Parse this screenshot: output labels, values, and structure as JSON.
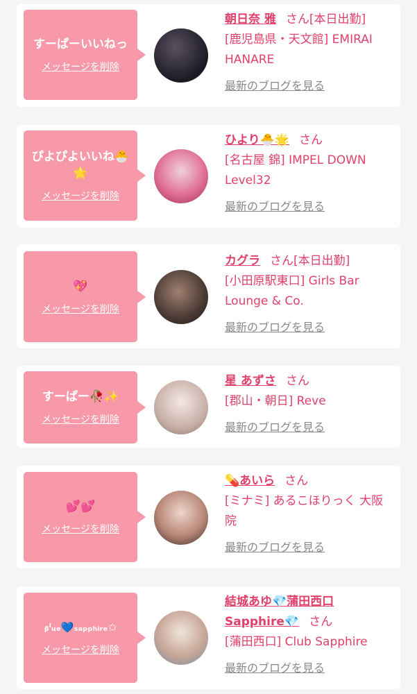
{
  "items": [
    {
      "message": "すーぱーいいねっ",
      "delete_label": "メッセージを削除",
      "name": "朝日奈 雅",
      "san": "さん",
      "tag": "[本日出勤]",
      "shop": "[鹿児島県・天文館] EMIRAI HANARE",
      "blog_label": "最新のブログを見る",
      "avatar_colors": [
        "#1a1a24",
        "#3a3040"
      ]
    },
    {
      "message": "ぴよぴよいいね🐣🌟",
      "delete_label": "メッセージを削除",
      "name": "ひより🐣🌟",
      "san": "さん",
      "tag": "",
      "shop": "[名古屋 錦] IMPEL DOWN Level32",
      "blog_label": "最新のブログを見る",
      "avatar_colors": [
        "#e8a0b8",
        "#c04870"
      ]
    },
    {
      "message": "💖",
      "delete_label": "メッセージを削除",
      "name": "カグラ",
      "san": "さん",
      "tag": "[本日出勤]",
      "shop": "[小田原駅東口] Girls Bar Lounge & Co.",
      "blog_label": "最新のブログを見る",
      "avatar_colors": [
        "#6a5448",
        "#2a2220"
      ]
    },
    {
      "message": "すーぱー🥀✨",
      "delete_label": "メッセージを削除",
      "name": "星 あずさ",
      "san": "さん",
      "tag": "",
      "shop": "[郡山・朝日] Reve",
      "blog_label": "最新のブログを見る",
      "avatar_colors": [
        "#d8c8c0",
        "#a89088"
      ]
    },
    {
      "message": "💕💕",
      "delete_label": "メッセージを削除",
      "name": "💊あいら",
      "san": "さん",
      "tag": "",
      "shop": "[ミナミ] あるこほりっく 大阪院",
      "blog_label": "最新のブログを見る",
      "avatar_colors": [
        "#c89888",
        "#584040"
      ]
    },
    {
      "message": "ᵦˡᵤₑ💙ₛₐₚₚₕᵢᵣₑ✩",
      "delete_label": "メッセージを削除",
      "name": "結城あゆ💎蒲田西口Sapphire💎",
      "san": "さん",
      "tag": "",
      "shop": "[蒲田西口] Club Sapphire",
      "blog_label": "最新のブログを見る",
      "avatar_colors": [
        "#d8c0b0",
        "#8aa8c8"
      ]
    }
  ]
}
